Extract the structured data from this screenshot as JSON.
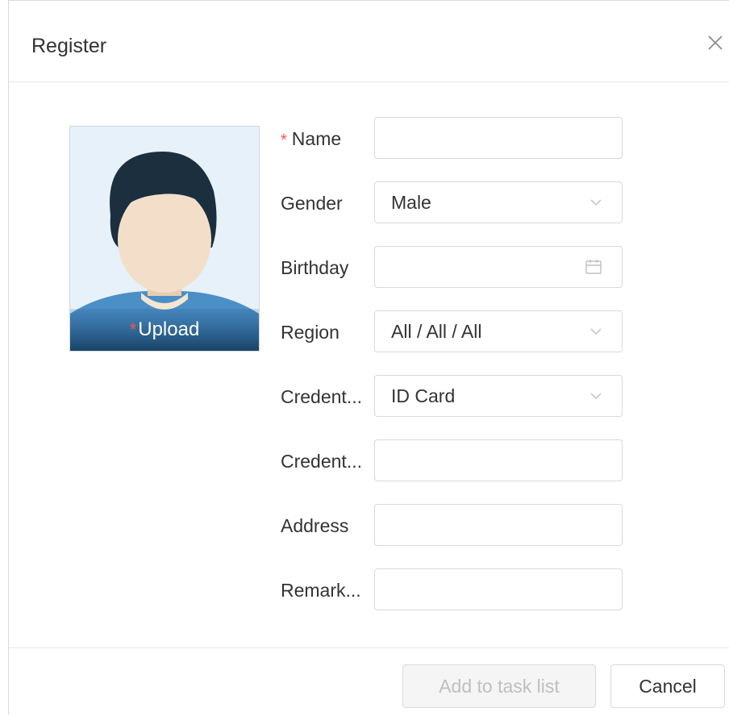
{
  "dialog": {
    "title": "Register",
    "close_icon": "close-icon"
  },
  "photo": {
    "required_mark": "*",
    "upload_label": "Upload",
    "icon": "avatar-placeholder"
  },
  "form": {
    "name": {
      "label": "Name",
      "required_mark": "*",
      "value": ""
    },
    "gender": {
      "label": "Gender",
      "value": "Male",
      "icon": "chevron-down-icon"
    },
    "birthday": {
      "label": "Birthday",
      "value": "",
      "icon": "calendar-icon"
    },
    "region": {
      "label": "Region",
      "value": "All / All / All",
      "icon": "chevron-down-icon"
    },
    "credential_type": {
      "label": "Credent...",
      "value": "ID Card",
      "icon": "chevron-down-icon"
    },
    "credential_no": {
      "label": "Credent...",
      "value": ""
    },
    "address": {
      "label": "Address",
      "value": ""
    },
    "remark": {
      "label": "Remark...",
      "value": ""
    }
  },
  "footer": {
    "add_label": "Add to task list",
    "cancel_label": "Cancel"
  },
  "colors": {
    "required": "#ff4d4f",
    "border": "#d9d9d9",
    "disabled_text": "#bfbfbf",
    "photo_bg": "#e6f1fa",
    "hair": "#1b2f3e",
    "shirt": "#4b8fc7"
  }
}
